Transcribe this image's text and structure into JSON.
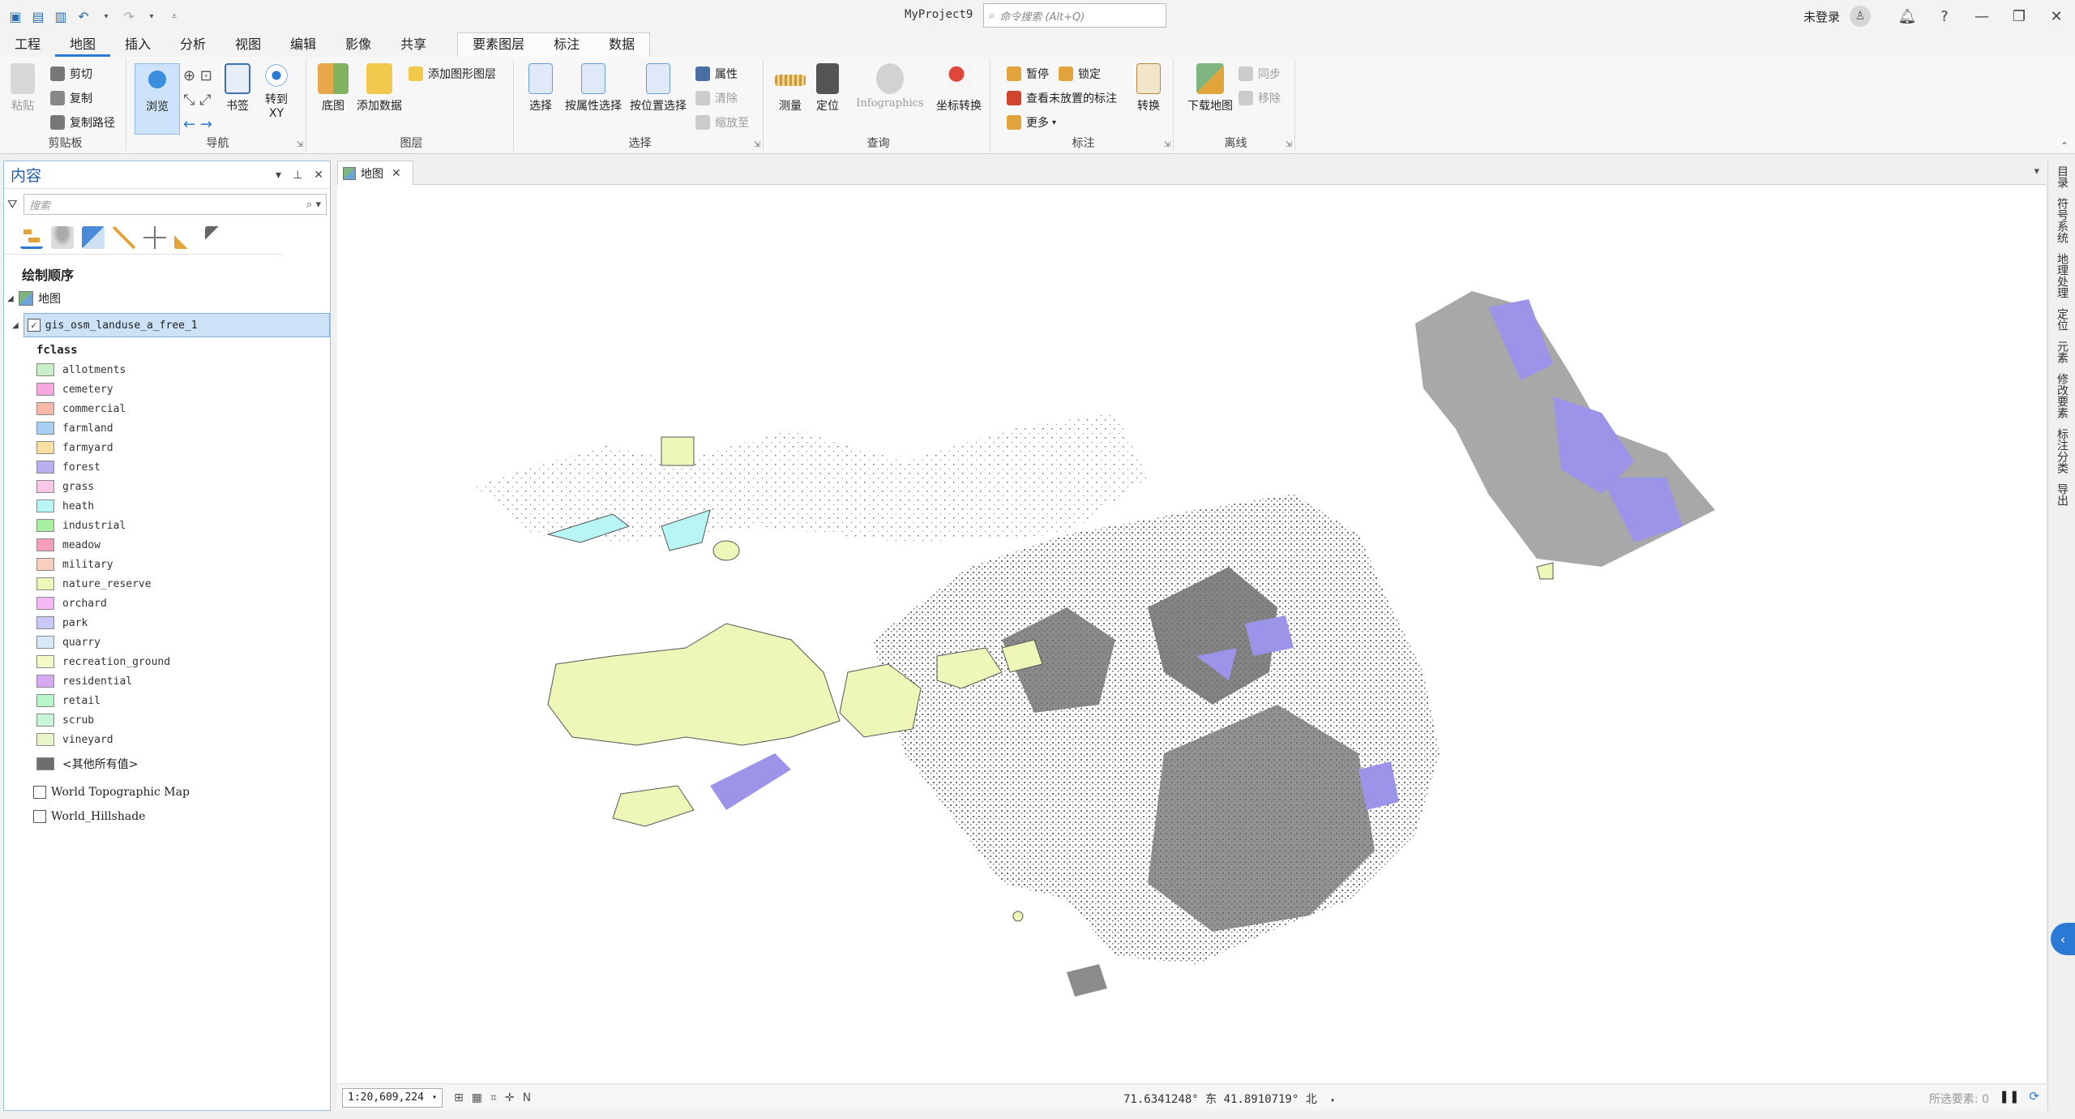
{
  "window": {
    "title": "MyProject9",
    "command_search_placeholder": "命令搜索 (Alt+Q)",
    "login": "未登录",
    "help": "?"
  },
  "ribbon_tabs": [
    "工程",
    "地图",
    "插入",
    "分析",
    "视图",
    "编辑",
    "影像",
    "共享"
  ],
  "active_tab": "地图",
  "context_tabs": [
    "要素图层",
    "标注",
    "数据"
  ],
  "ribbon": {
    "clipboard": {
      "label": "剪贴板",
      "paste": "粘贴",
      "cut": "剪切",
      "copy": "复制",
      "copy_path": "复制路径"
    },
    "navigate": {
      "label": "导航",
      "explore": "浏览",
      "bookmarks": "书签",
      "goto_xy": "转到\nXY"
    },
    "layer": {
      "label": "图层",
      "basemap": "底图",
      "add_data": "添加数据",
      "add_graphics": "添加图形图层"
    },
    "selection": {
      "label": "选择",
      "select": "选择",
      "by_attr": "按属性选择",
      "by_location": "按位置选择",
      "attributes": "属性",
      "clear": "清除",
      "zoom_to": "缩放至"
    },
    "inquiry": {
      "label": "查询",
      "measure": "测量",
      "locate": "定位",
      "infographics": "Infographics",
      "convert_coords": "坐标转换"
    },
    "labeling": {
      "label": "标注",
      "pause": "暂停",
      "lock": "锁定",
      "view_unplaced": "查看未放置的标注",
      "more": "更多",
      "convert": "转换"
    },
    "offline": {
      "label": "离线",
      "download_map": "下载地图",
      "sync": "同步",
      "remove": "移除"
    }
  },
  "contents": {
    "title": "内容",
    "search_placeholder": "搜索",
    "drawing_order": "绘制顺序",
    "map_name": "地图",
    "layer_name": "gis_osm_landuse_a_free_1",
    "field": "fclass",
    "legend": [
      {
        "label": "allotments",
        "color": "#c8f0c8"
      },
      {
        "label": "cemetery",
        "color": "#f5a8e0"
      },
      {
        "label": "commercial",
        "color": "#f7b8a8"
      },
      {
        "label": "farmland",
        "color": "#a8d0f5"
      },
      {
        "label": "farmyard",
        "color": "#f9e0a0"
      },
      {
        "label": "forest",
        "color": "#b8b0f0"
      },
      {
        "label": "grass",
        "color": "#f9c8e8"
      },
      {
        "label": "heath",
        "color": "#b8f5f5"
      },
      {
        "label": "industrial",
        "color": "#a8f0a0"
      },
      {
        "label": "meadow",
        "color": "#f5a0b8"
      },
      {
        "label": "military",
        "color": "#f9d0c0"
      },
      {
        "label": "nature_reserve",
        "color": "#eef7b8"
      },
      {
        "label": "orchard",
        "color": "#f5b8f5"
      },
      {
        "label": "park",
        "color": "#c8c8f9"
      },
      {
        "label": "quarry",
        "color": "#d8e8f9"
      },
      {
        "label": "recreation_ground",
        "color": "#f5f9c8"
      },
      {
        "label": "residential",
        "color": "#d8a8f0"
      },
      {
        "label": "retail",
        "color": "#b8f5c8"
      },
      {
        "label": "scrub",
        "color": "#c8f5d8"
      },
      {
        "label": "vineyard",
        "color": "#e8f5c8"
      }
    ],
    "other_values": "<其他所有值>",
    "other_color": "#6e6e6e",
    "basemaps": [
      "World Topographic Map",
      "World_Hillshade"
    ]
  },
  "map_view": {
    "tab_label": "地图",
    "scale": "1:20,609,224",
    "coordinates": "71.6341248° 东  41.8910719° 北",
    "selected_features": "所选要素: 0"
  },
  "right_panels": [
    "目录",
    "符号系统",
    "地理处理",
    "定位",
    "元素",
    "修改要素",
    "标注分类",
    "导出"
  ],
  "colors": {
    "accent": "#2a7ad5",
    "forest": "#9c94e8",
    "nature_reserve": "#eef7b8",
    "heath": "#b8f5f5",
    "other": "#6e6e6e"
  }
}
